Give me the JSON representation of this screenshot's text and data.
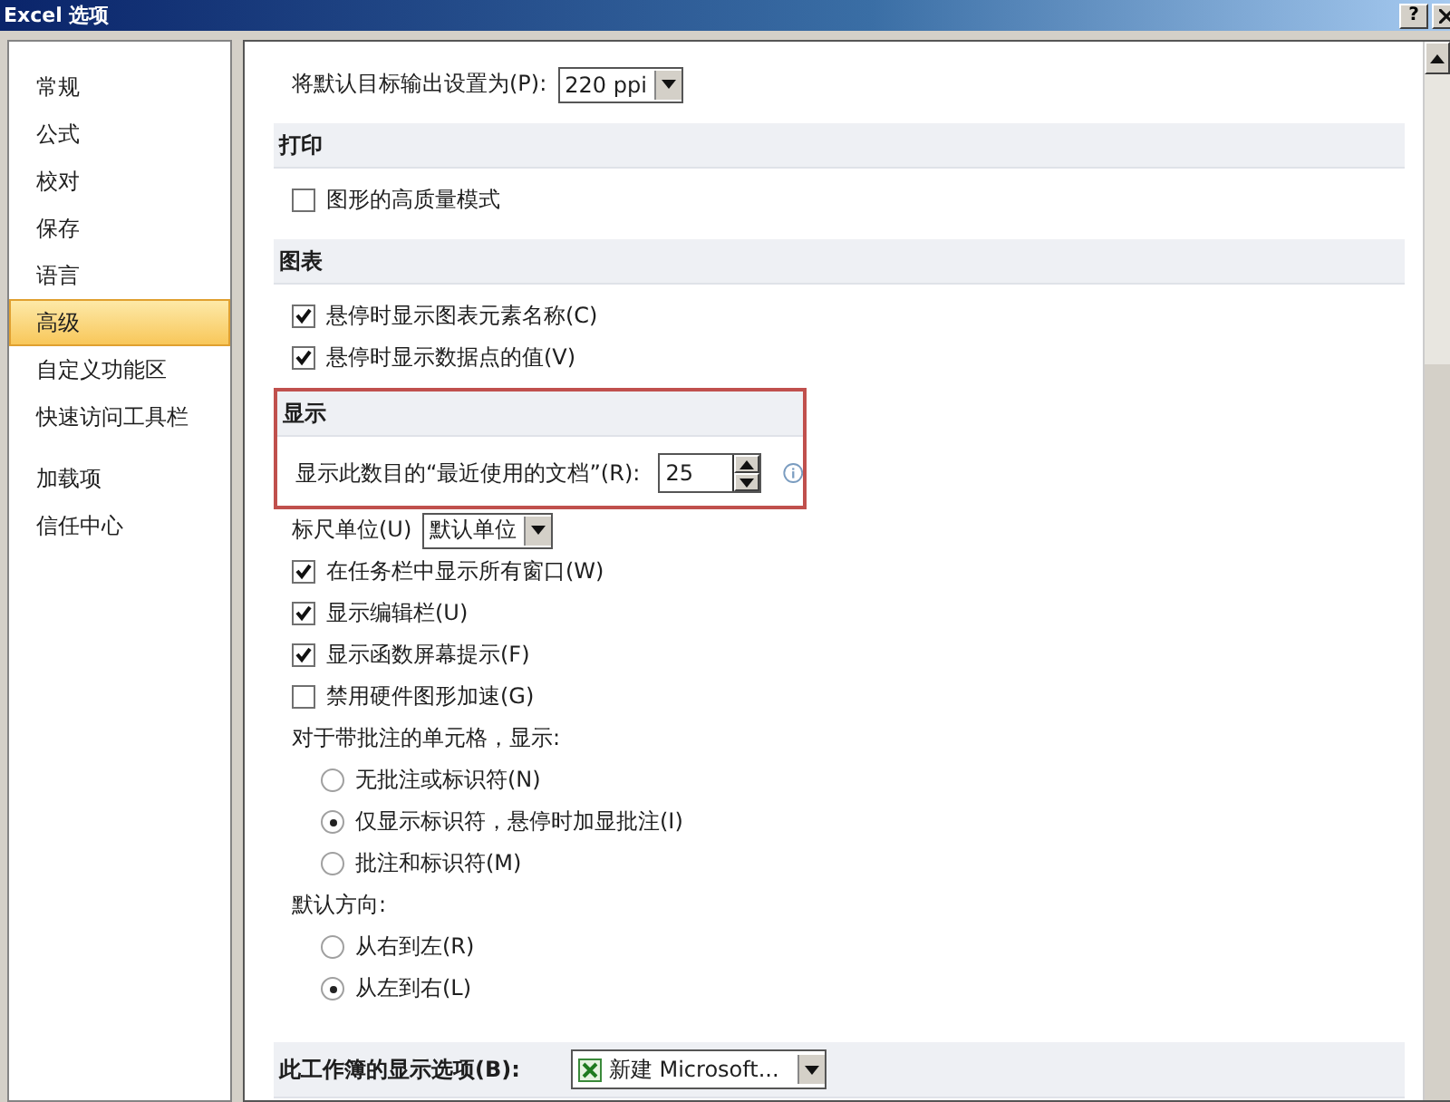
{
  "window": {
    "title": "Excel 选项",
    "buttons": [
      "?"
    ]
  },
  "sidebar": {
    "groups": [
      [
        {
          "label": "常规",
          "selected": false
        },
        {
          "label": "公式",
          "selected": false
        },
        {
          "label": "校对",
          "selected": false
        },
        {
          "label": "保存",
          "selected": false
        },
        {
          "label": "语言",
          "selected": false
        },
        {
          "label": "高级",
          "selected": true
        },
        {
          "label": "自定义功能区",
          "selected": false
        },
        {
          "label": "快速访问工具栏",
          "selected": false
        }
      ],
      [
        {
          "label": "加载项",
          "selected": false
        },
        {
          "label": "信任中心",
          "selected": false
        }
      ]
    ]
  },
  "sections": [
    {
      "highlighted": false,
      "items": [
        {
          "kind": "select",
          "label": "将默认目标输出设置为(P):",
          "value": "220 ppi"
        }
      ]
    },
    {
      "title": "打印",
      "highlighted": false,
      "items": [
        {
          "kind": "checkbox",
          "label": "图形的高质量模式",
          "checked": false
        }
      ]
    },
    {
      "title": "图表",
      "highlighted": false,
      "items": [
        {
          "kind": "checkbox",
          "label": "悬停时显示图表元素名称(C)",
          "checked": true
        },
        {
          "kind": "checkbox",
          "label": "悬停时显示数据点的值(V)",
          "checked": true
        }
      ]
    },
    {
      "title": "显示",
      "highlighted": true,
      "items": [
        {
          "kind": "spinner",
          "label": "显示此数目的“最近使用的文档”(R):",
          "value": "25"
        }
      ]
    },
    {
      "highlighted": false,
      "items": [
        {
          "kind": "select",
          "label": "标尺单位(U)",
          "value": "默认单位"
        },
        {
          "kind": "checkbox",
          "label": "在任务栏中显示所有窗口(W)",
          "checked": true
        },
        {
          "kind": "checkbox",
          "label": "显示编辑栏(U)",
          "checked": true
        },
        {
          "kind": "checkbox",
          "label": "显示函数屏幕提示(F)",
          "checked": true
        },
        {
          "kind": "checkbox",
          "label": "禁用硬件图形加速(G)",
          "checked": false
        },
        {
          "kind": "label",
          "label": "对于带批注的单元格，显示:"
        },
        {
          "kind": "radio",
          "label": "无批注或标识符(N)",
          "selected": false
        },
        {
          "kind": "radio",
          "label": "仅显示标识符，悬停时加显批注(I)",
          "selected": true
        },
        {
          "kind": "radio",
          "label": "批注和标识符(M)",
          "selected": false
        },
        {
          "kind": "label",
          "label": "默认方向:"
        },
        {
          "kind": "radio",
          "label": "从右到左(R)",
          "selected": false
        },
        {
          "kind": "radio",
          "label": "从左到右(L)",
          "selected": true
        }
      ]
    },
    {
      "title": "此工作簿的显示选项(B):",
      "highlighted": false,
      "control": {
        "kind": "workbook_select",
        "value": "新建 Microsoft..."
      }
    }
  ]
}
